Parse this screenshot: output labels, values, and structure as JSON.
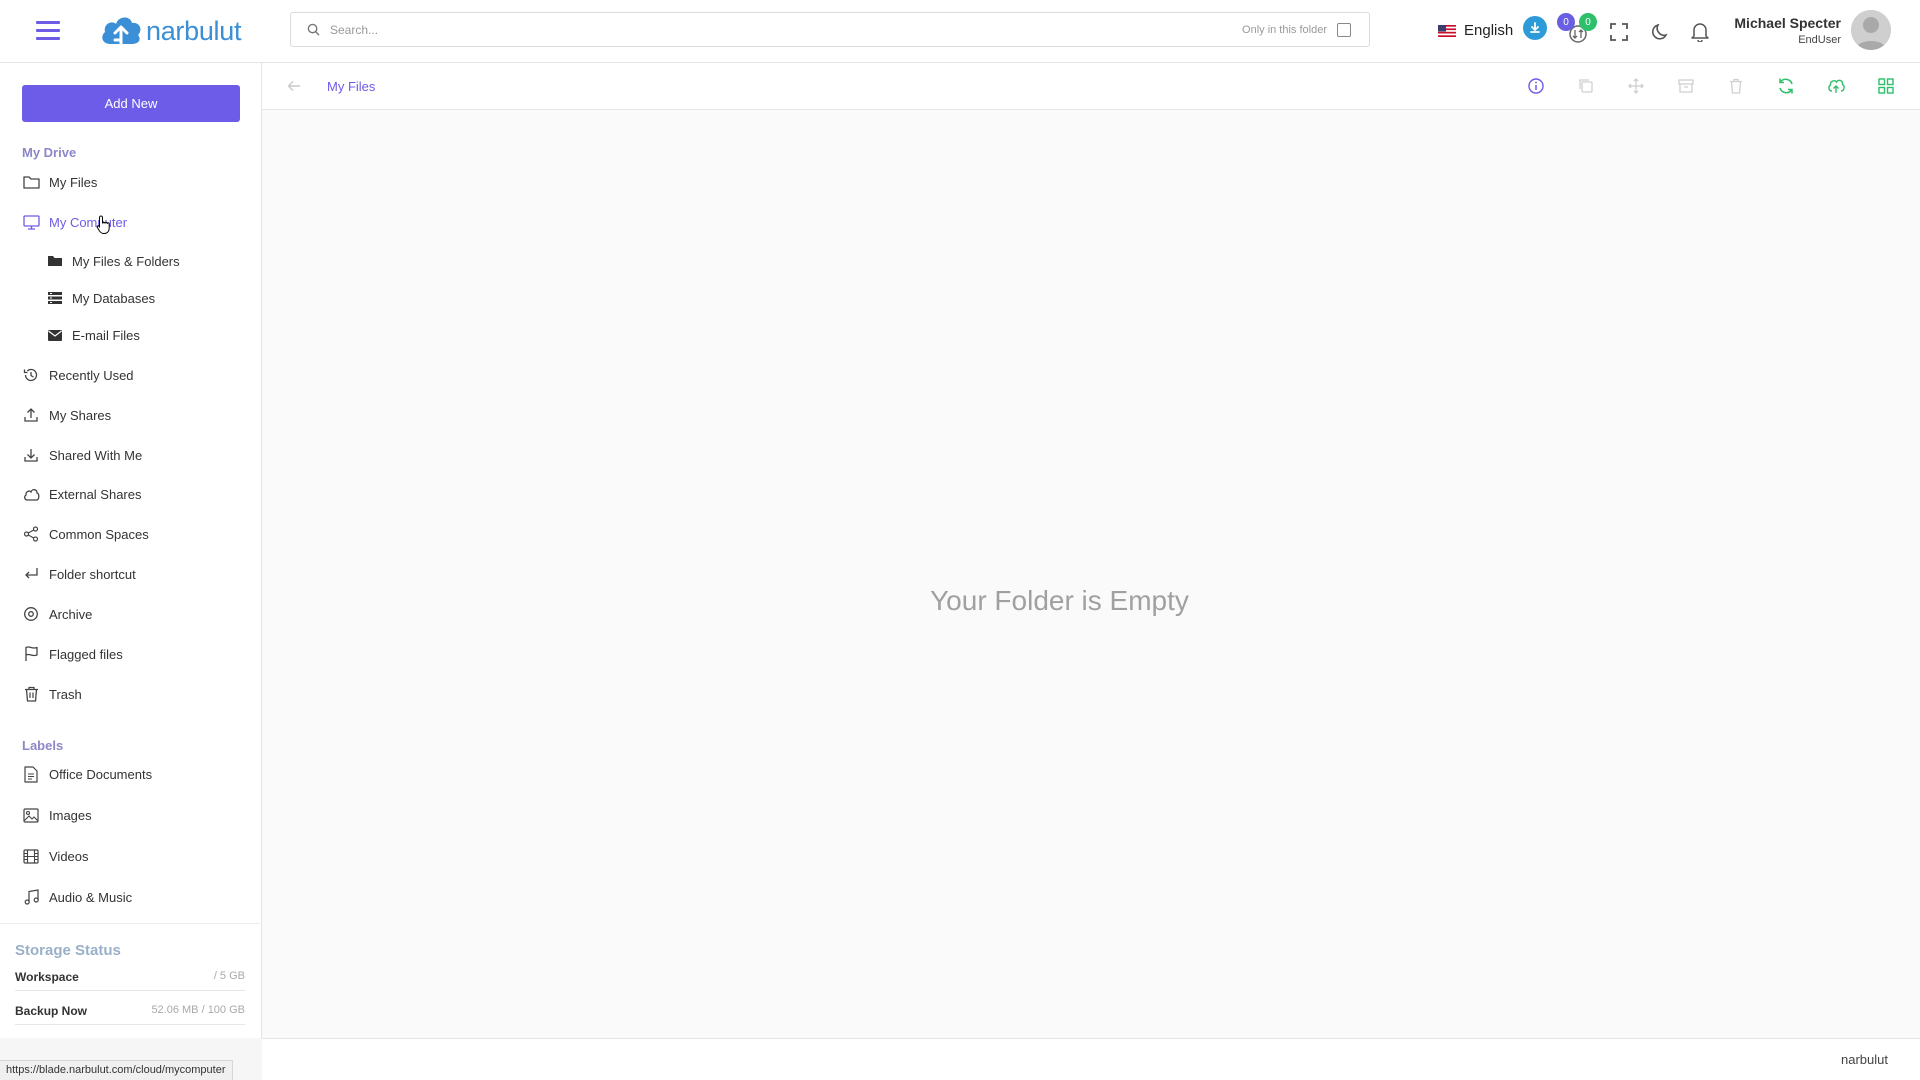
{
  "header": {
    "brand": "narbulut",
    "search_placeholder": "Search...",
    "only_in_folder": "Only in this folder",
    "language": "English",
    "badge_left": "0",
    "badge_right": "0",
    "user_name": "Michael Specter",
    "user_role": "EndUser"
  },
  "sidebar": {
    "add_new": "Add New",
    "my_drive_label": "My Drive",
    "items": [
      {
        "label": "My Files",
        "icon": "folder-icon"
      },
      {
        "label": "My Computer",
        "icon": "monitor-icon"
      },
      {
        "label": "My Files & Folders",
        "icon": "folder-solid-icon"
      },
      {
        "label": "My Databases",
        "icon": "database-icon"
      },
      {
        "label": "E-mail Files",
        "icon": "envelope-icon"
      },
      {
        "label": "Recently Used",
        "icon": "history-icon"
      },
      {
        "label": "My Shares",
        "icon": "upload-icon"
      },
      {
        "label": "Shared With Me",
        "icon": "download-icon"
      },
      {
        "label": "External Shares",
        "icon": "cloud-icon"
      },
      {
        "label": "Common Spaces",
        "icon": "share-icon"
      },
      {
        "label": "Folder shortcut",
        "icon": "return-arrow-icon"
      },
      {
        "label": "Archive",
        "icon": "target-icon"
      },
      {
        "label": "Flagged files",
        "icon": "flag-icon"
      },
      {
        "label": "Trash",
        "icon": "trash-icon"
      }
    ],
    "labels_label": "Labels",
    "labels": [
      {
        "label": "Office Documents",
        "icon": "document-icon"
      },
      {
        "label": "Images",
        "icon": "image-icon"
      },
      {
        "label": "Videos",
        "icon": "film-icon"
      },
      {
        "label": "Audio & Music",
        "icon": "music-icon"
      }
    ],
    "storage": {
      "title": "Storage Status",
      "workspace_label": "Workspace",
      "workspace_value": "/ 5 GB",
      "backup_label": "Backup Now",
      "backup_value": "52.06 MB / 100 GB"
    }
  },
  "toolbar": {
    "breadcrumb": "My Files"
  },
  "main": {
    "empty_message": "Your Folder is Empty"
  },
  "footer": {
    "brand": "narbulut"
  },
  "statusbar": {
    "url": "https://blade.narbulut.com/cloud/mycomputer"
  },
  "colors": {
    "accent": "#6c5ce7",
    "brand_blue": "#3a8fd6",
    "green": "#2ebf6a"
  }
}
